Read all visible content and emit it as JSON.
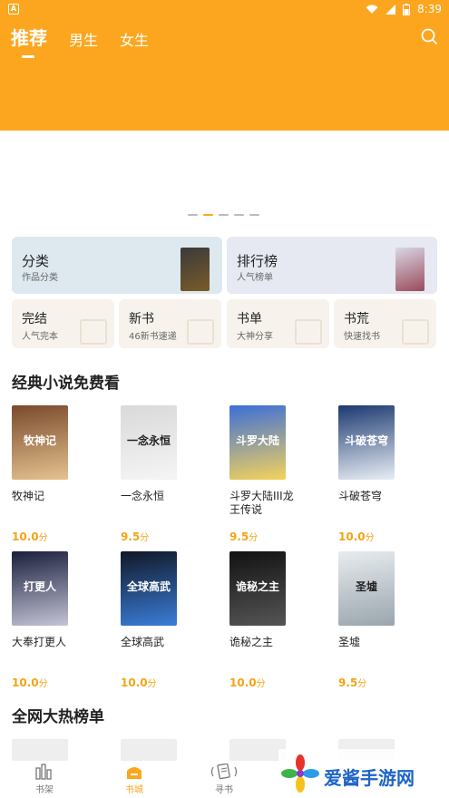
{
  "status_bar": {
    "time": "8:39",
    "battery": "8"
  },
  "header": {
    "tabs": [
      "推荐",
      "男生",
      "女生"
    ],
    "active_tab": "推荐"
  },
  "categories": {
    "big": [
      {
        "title": "分类",
        "subtitle": "作品分类",
        "bg": "#dde9ef"
      },
      {
        "title": "排行榜",
        "subtitle": "人气榜单",
        "bg": "#e6e9f2"
      }
    ],
    "small": [
      {
        "title": "完结",
        "subtitle": "人气完本"
      },
      {
        "title": "新书",
        "subtitle": "46新书速递"
      },
      {
        "title": "书单",
        "subtitle": "大神分享"
      },
      {
        "title": "书荒",
        "subtitle": "快速找书"
      }
    ]
  },
  "section_free": {
    "title": "经典小说免费看",
    "books": [
      {
        "name": "牧神记",
        "score": "10.0",
        "unit": "分",
        "cover_text": "牧神记",
        "colors": [
          "#7a4a2c",
          "#e5c28f"
        ]
      },
      {
        "name": "一念永恒",
        "score": "9.5",
        "unit": "分",
        "cover_text": "一念永恒",
        "colors": [
          "#d9d9d9",
          "#f5f5f5"
        ]
      },
      {
        "name": "斗罗大陆III龙王传说",
        "score": "9.5",
        "unit": "分",
        "cover_text": "斗罗大陆",
        "colors": [
          "#3c6fd8",
          "#f4d25c"
        ]
      },
      {
        "name": "斗破苍穹",
        "score": "10.0",
        "unit": "分",
        "cover_text": "斗破苍穹",
        "colors": [
          "#1c3a70",
          "#e9eef5"
        ]
      },
      {
        "name": "大奉打更人",
        "score": "10.0",
        "unit": "分",
        "cover_text": "打更人",
        "colors": [
          "#1a1f3d",
          "#c4c4d6"
        ]
      },
      {
        "name": "全球高武",
        "score": "10.0",
        "unit": "分",
        "cover_text": "全球高武",
        "colors": [
          "#111827",
          "#3a7dd8"
        ]
      },
      {
        "name": "诡秘之主",
        "score": "10.0",
        "unit": "分",
        "cover_text": "诡秘之主",
        "colors": [
          "#121212",
          "#555555"
        ]
      },
      {
        "name": "圣墟",
        "score": "9.5",
        "unit": "分",
        "cover_text": "圣墟",
        "colors": [
          "#e7ecef",
          "#9aa5ad"
        ]
      }
    ]
  },
  "section_hot": {
    "title": "全网大热榜单"
  },
  "bottom_nav": [
    {
      "label": "书架",
      "icon": "bookshelf-icon"
    },
    {
      "label": "书城",
      "icon": "bookstore-icon"
    },
    {
      "label": "寻书",
      "icon": "find-book-icon"
    }
  ],
  "watermark": {
    "text": "爱酱手游网"
  }
}
